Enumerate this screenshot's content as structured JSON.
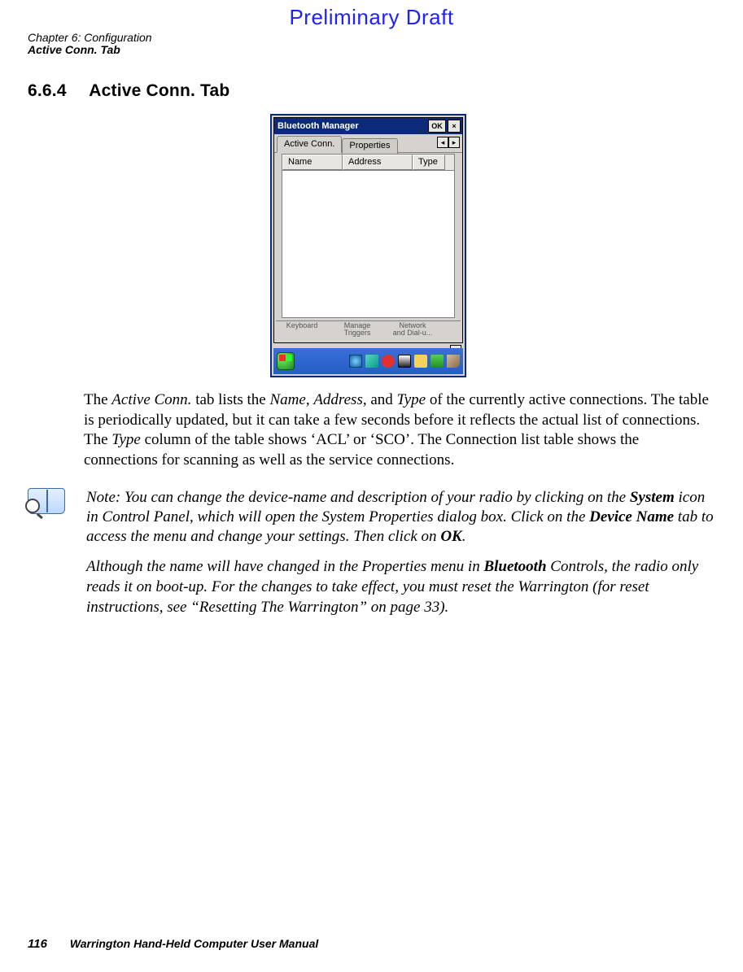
{
  "watermark": "Preliminary Draft",
  "header": {
    "line1": "Chapter 6: Configuration",
    "line2": "Active Conn. Tab"
  },
  "section": {
    "number": "6.6.4",
    "title": "Active Conn. Tab"
  },
  "device_shot": {
    "window_title": "Bluetooth Manager",
    "ok_label": "OK",
    "close_glyph": "×",
    "tabs": {
      "active": "Active Conn.",
      "inactive": "Properties",
      "scroll_left": "◂",
      "scroll_right": "▸"
    },
    "columns": {
      "name": "Name",
      "address": "Address",
      "type": "Type"
    },
    "desktop": {
      "item1": "Keyboard",
      "item2_line1": "Manage",
      "item2_line2": "Triggers",
      "item3_line1": "Network",
      "item3_line2": "and Dial-u..."
    },
    "scroll_down": "▾"
  },
  "body": {
    "p1_a": "The ",
    "p1_i1": "Active Conn.",
    "p1_b": " tab lists the ",
    "p1_i2": "Name",
    "p1_c": ", ",
    "p1_i3": "Address",
    "p1_d": ", and ",
    "p1_i4": "Type",
    "p1_e": " of the currently active connections. The table is periodically updated, but it can take a few seconds before it reflects the actual list of connections. The ",
    "p1_i5": "Type",
    "p1_f": " column of the table shows ‘ACL’ or ‘SCO’. The Connection list table shows the connections for scanning as well as the service connections."
  },
  "note": {
    "label": "Note: ",
    "p1_a": "You can change the device-name and description of your radio by clicking on the ",
    "p1_b1": "System",
    "p1_b": " icon in Control Panel, which will open the System Properties dialog box. Click on the ",
    "p1_b2": "Device Name",
    "p1_c": " tab to access the menu and change your settings. Then click on ",
    "p1_b3": "OK",
    "p1_d": ".",
    "p2_a": "Although the name will have changed in the Properties menu in ",
    "p2_b1": "Bluetooth",
    "p2_b": " Controls, the radio only reads it on boot-up. For the changes to take effect, you must reset the Warrington (for reset instructions, see “Resetting The Warrington” on page 33)."
  },
  "footer": {
    "page": "116",
    "text": "Warrington Hand-Held Computer User Manual"
  }
}
